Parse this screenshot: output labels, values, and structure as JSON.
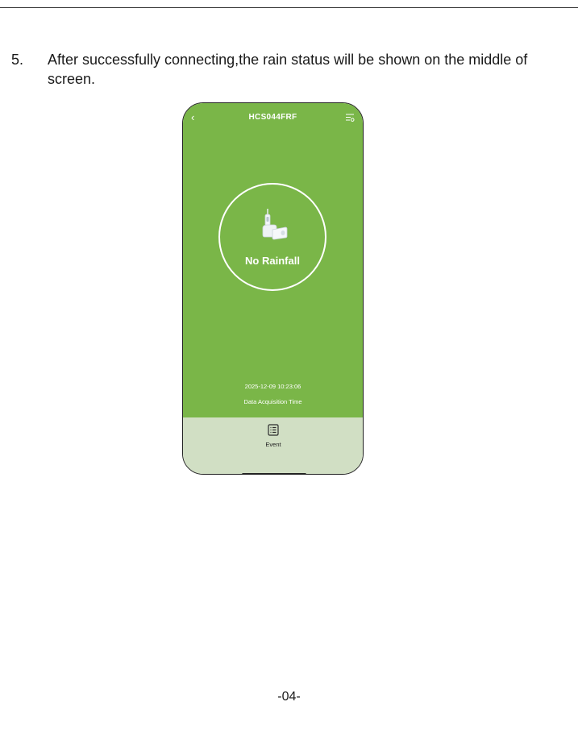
{
  "instruction": {
    "number": "5.",
    "text": "After successfully connecting,the rain status will be shown on the middle of screen."
  },
  "phone": {
    "header": {
      "back_icon": "chevron-left-icon",
      "title": "HCS044FRF",
      "settings_icon": "list-settings-icon"
    },
    "status": {
      "device_icon": "rain-sensor-device-icon",
      "label": "No Rainfall"
    },
    "acquisition": {
      "time": "2025-12-09 10:23:06",
      "label": "Data Acquisition Time"
    },
    "bottom_bar": {
      "event_icon": "event-list-icon",
      "event_label": "Event"
    }
  },
  "page_number": "-04-",
  "colors": {
    "screen_green": "#7ab648",
    "bottom_panel": "#d1dfc4",
    "text": "#1a1a1a"
  }
}
